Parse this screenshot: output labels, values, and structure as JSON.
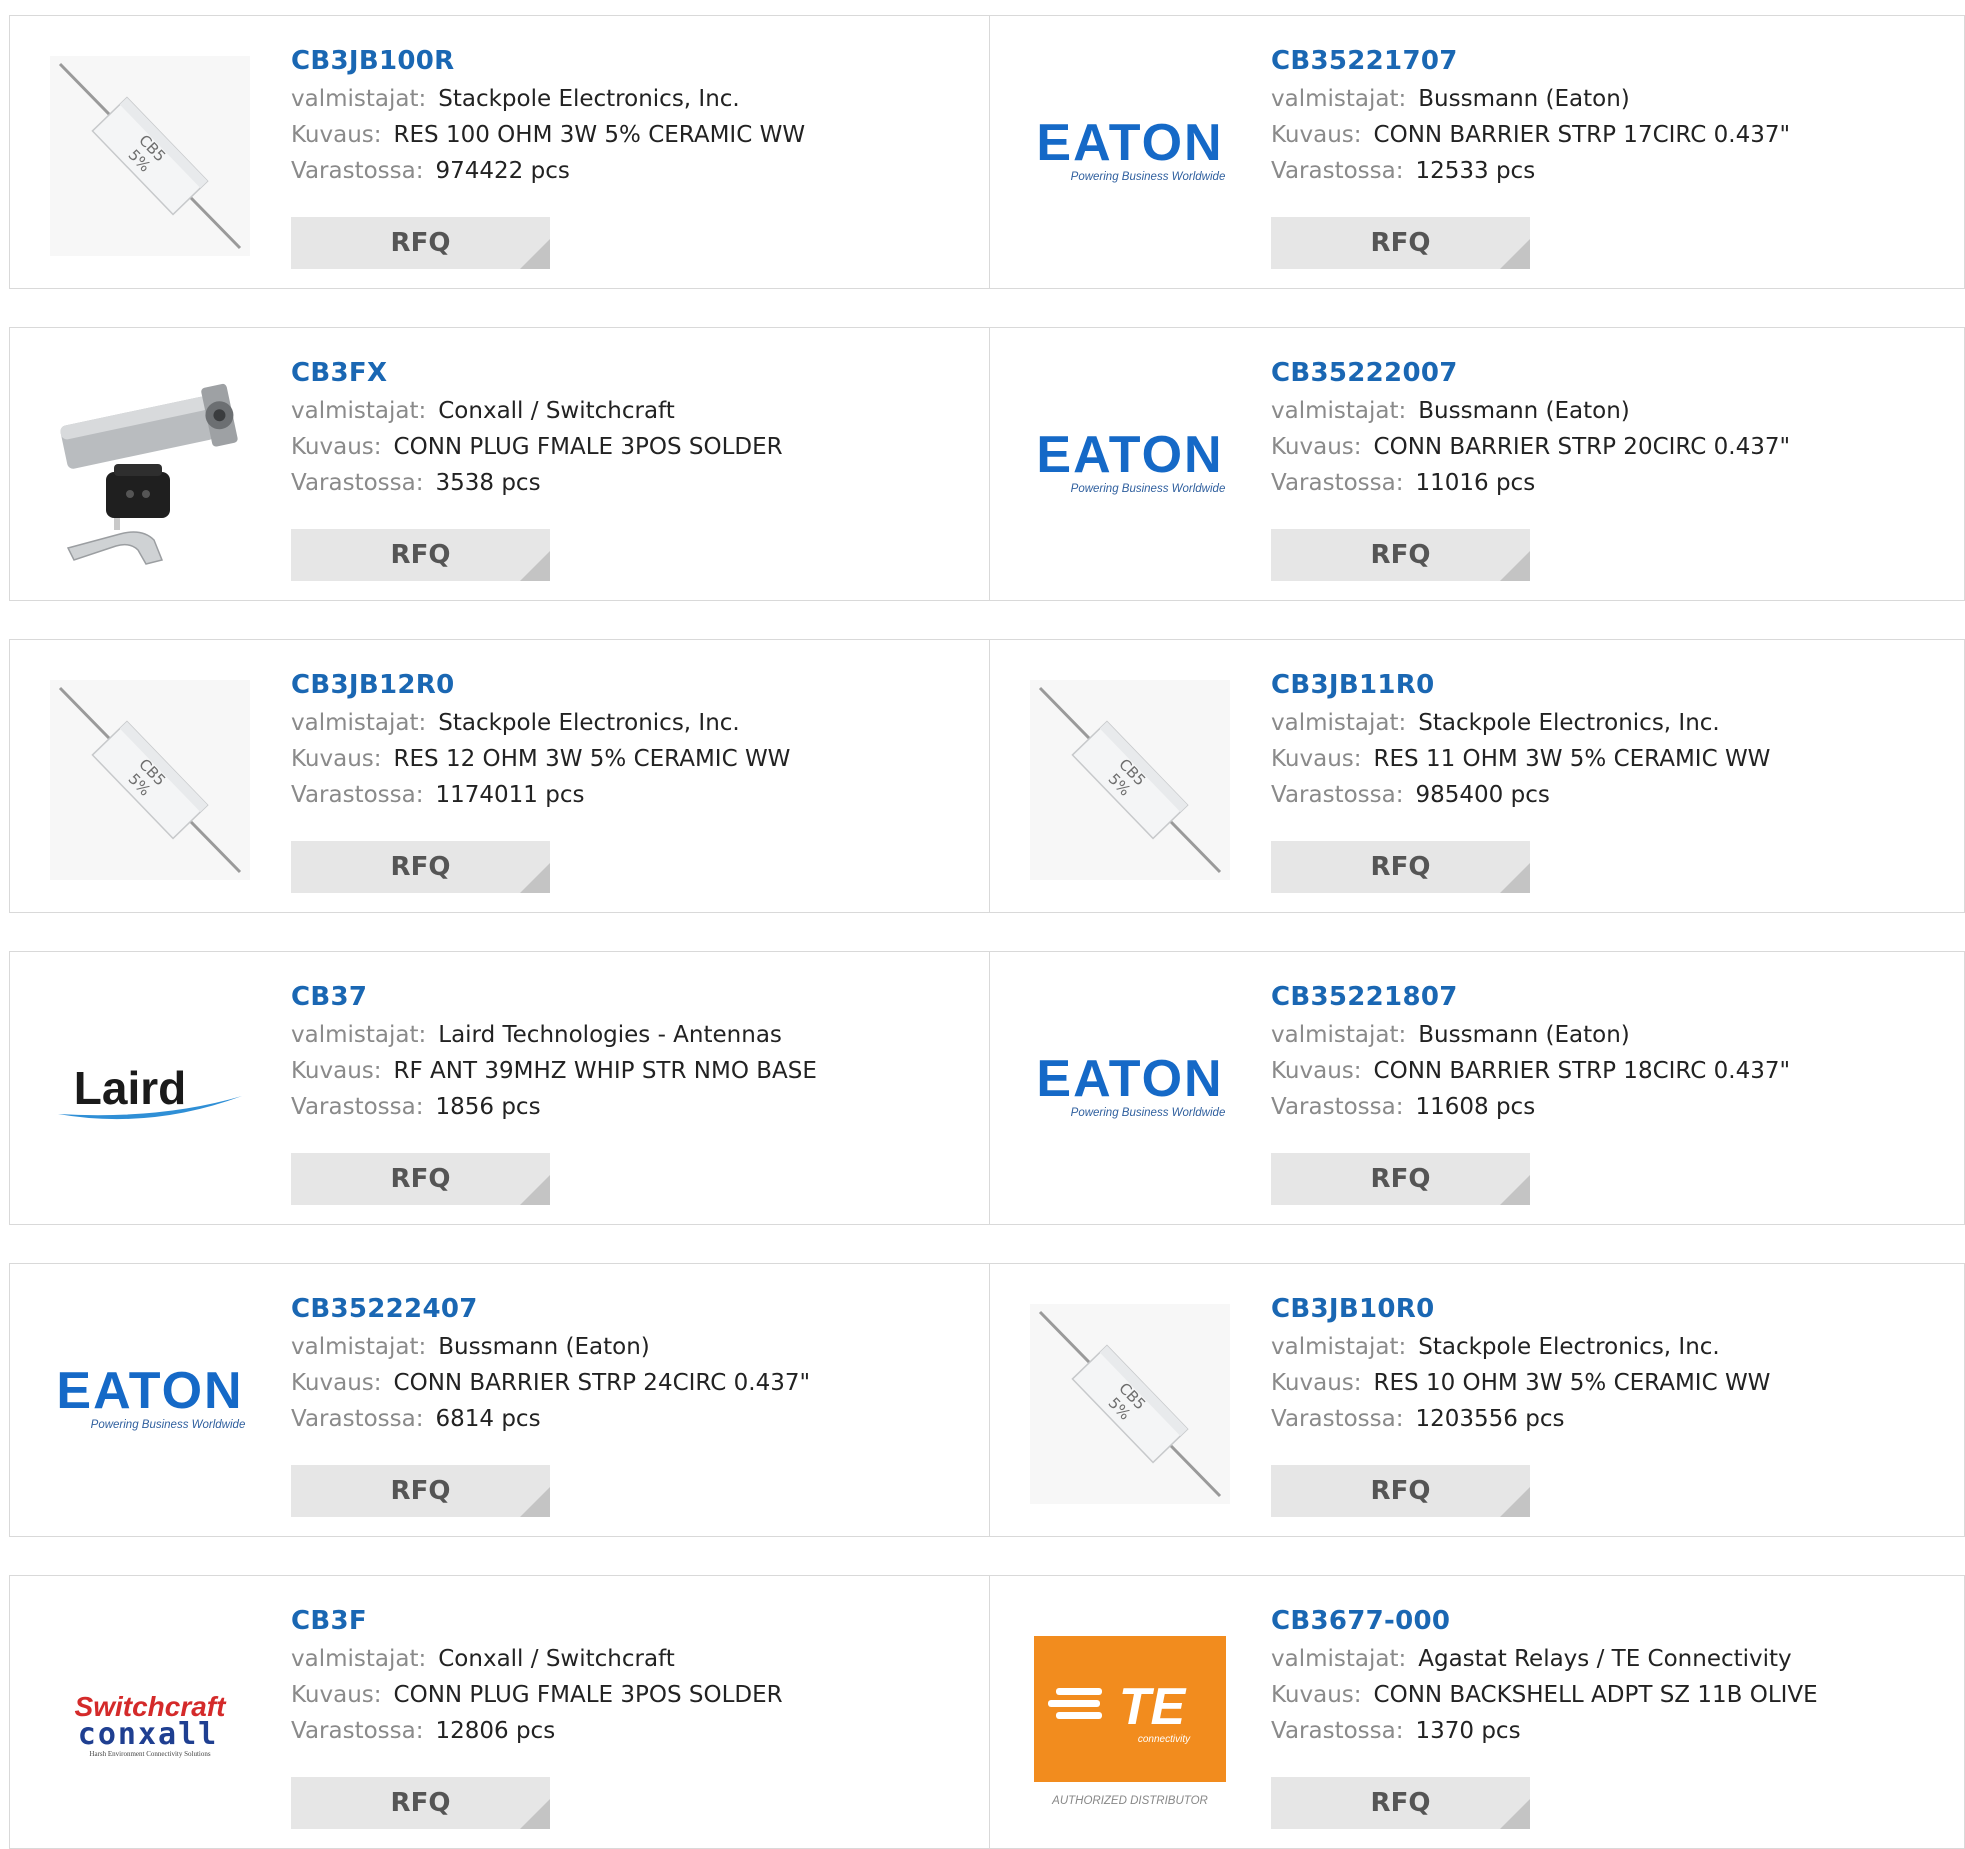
{
  "labels": {
    "manufacturer": "valmistajat:",
    "description": "Kuvaus:",
    "stock": "Varastossa:",
    "rfq": "RFQ"
  },
  "logo_text": {
    "eaton": "EATON",
    "eaton_tagline": "Powering Business Worldwide",
    "laird": "Laird",
    "switchcraft": "Switchcraft",
    "conxall": "conxall",
    "conxall_tagline": "Harsh Environment Connectivity Solutions",
    "te": "TE",
    "te_sub": "connectivity",
    "te_authorized": "AUTHORIZED DISTRIBUTOR",
    "resistor_marking_1": "CB5",
    "resistor_marking_2": "5%"
  },
  "products": [
    {
      "pn": "CB3JB100R",
      "manufacturer": "Stackpole Electronics, Inc.",
      "description": "RES 100 OHM 3W 5% CERAMIC WW",
      "stock": "974422 pcs",
      "image": "resistor-image"
    },
    {
      "pn": "CB35221707",
      "manufacturer": "Bussmann (Eaton)",
      "description": "CONN BARRIER STRP 17CIRC 0.437\"",
      "stock": "12533 pcs",
      "image": "eaton-logo"
    },
    {
      "pn": "CB3FX",
      "manufacturer": "Conxall / Switchcraft",
      "description": "CONN PLUG FMALE 3POS SOLDER",
      "stock": "3538 pcs",
      "image": "connector-plug-image"
    },
    {
      "pn": "CB35222007",
      "manufacturer": "Bussmann (Eaton)",
      "description": "CONN BARRIER STRP 20CIRC 0.437\"",
      "stock": "11016 pcs",
      "image": "eaton-logo"
    },
    {
      "pn": "CB3JB12R0",
      "manufacturer": "Stackpole Electronics, Inc.",
      "description": "RES 12 OHM 3W 5% CERAMIC WW",
      "stock": "1174011 pcs",
      "image": "resistor-image"
    },
    {
      "pn": "CB3JB11R0",
      "manufacturer": "Stackpole Electronics, Inc.",
      "description": "RES 11 OHM 3W 5% CERAMIC WW",
      "stock": "985400 pcs",
      "image": "resistor-image"
    },
    {
      "pn": "CB37",
      "manufacturer": "Laird Technologies - Antennas",
      "description": "RF ANT 39MHZ WHIP STR NMO BASE",
      "stock": "1856 pcs",
      "image": "laird-logo"
    },
    {
      "pn": "CB35221807",
      "manufacturer": "Bussmann (Eaton)",
      "description": "CONN BARRIER STRP 18CIRC 0.437\"",
      "stock": "11608 pcs",
      "image": "eaton-logo"
    },
    {
      "pn": "CB35222407",
      "manufacturer": "Bussmann (Eaton)",
      "description": "CONN BARRIER STRP 24CIRC 0.437\"",
      "stock": "6814 pcs",
      "image": "eaton-logo"
    },
    {
      "pn": "CB3JB10R0",
      "manufacturer": "Stackpole Electronics, Inc.",
      "description": "RES 10 OHM 3W 5% CERAMIC WW",
      "stock": "1203556 pcs",
      "image": "resistor-image"
    },
    {
      "pn": "CB3F",
      "manufacturer": "Conxall / Switchcraft",
      "description": "CONN PLUG FMALE 3POS SOLDER",
      "stock": "12806 pcs",
      "image": "switchcraft-conxall-logo"
    },
    {
      "pn": "CB3677-000",
      "manufacturer": "Agastat Relays / TE Connectivity",
      "description": "CONN BACKSHELL ADPT SZ 11B OLIVE",
      "stock": "1370 pcs",
      "image": "te-connectivity-logo"
    }
  ],
  "colors": {
    "part_number": "#1a67b3",
    "label": "#8a8a8a",
    "value": "#222222",
    "rfq_bg": "#e6e6e6",
    "rfq_text": "#555555",
    "border": "#d9d9d9",
    "eaton_blue": "#1569c7",
    "te_orange": "#f28c1e",
    "switchcraft_red": "#d42a2a",
    "conxall_blue": "#1f3f91"
  }
}
